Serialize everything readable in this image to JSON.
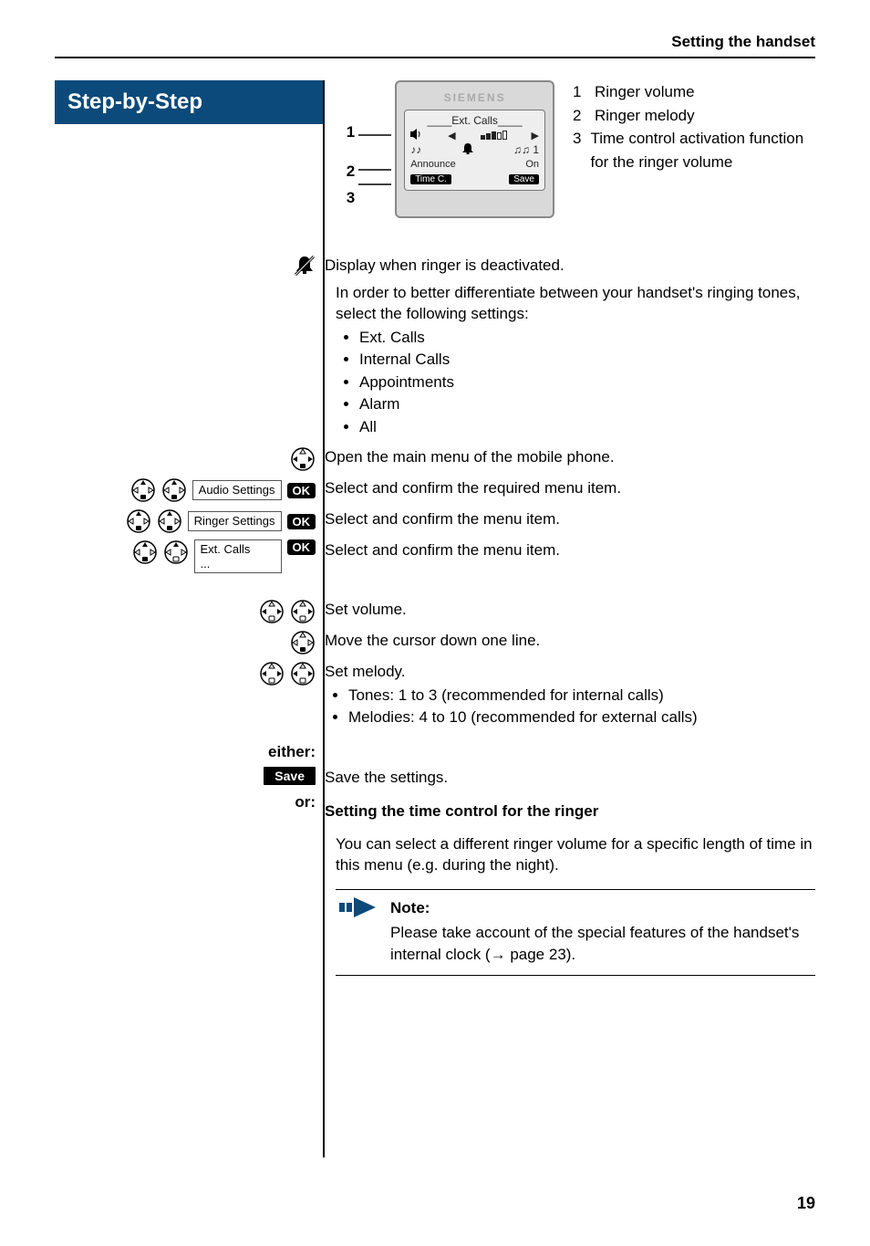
{
  "header": {
    "running": "Setting the handset"
  },
  "banner": "Step-by-Step",
  "device": {
    "brand": "SIEMENS",
    "title": "Ext. Calls",
    "announce": "Announce",
    "on": "On",
    "melodyNum": "1",
    "timec": "Time C.",
    "save": "Save",
    "callouts": {
      "n1": "1",
      "n2": "2",
      "n3": "3"
    }
  },
  "legend": {
    "r1": {
      "n": "1",
      "t": "Ringer volume"
    },
    "r2": {
      "n": "2",
      "t": "Ringer melody"
    },
    "r3": {
      "n": "3",
      "t": "Time control activation function for the ringer volume"
    }
  },
  "para": {
    "deactivated": "Display when ringer is deactivated.",
    "diff": "In order to better differentiate between your handset's ringing tones, select the following settings:",
    "openMain": "Open the main menu of the mobile phone.",
    "selectReq": "Select and confirm the required menu item.",
    "selectMenu": "Select and confirm the menu item.",
    "setVol": "Set volume.",
    "moveDown": "Move the cursor down one line.",
    "setMelody": "Set melody.",
    "saveSettings": "Save the settings.",
    "timeCtrlHead": "Setting the time control for the ringer",
    "timeCtrlBody": "You can select a different ringer volume for a specific length of time in this menu (e.g. during the night)."
  },
  "settingsList": [
    "Ext. Calls",
    "Internal Calls",
    "Appointments",
    "Alarm",
    "All"
  ],
  "melodyList": [
    "Tones: 1 to 3 (recommended for internal calls)",
    "Melodies: 4 to 10 (recommended for external calls)"
  ],
  "menuItems": {
    "audio": "Audio Settings",
    "ringer": "Ringer Settings",
    "ext": "Ext. Calls\n..."
  },
  "badges": {
    "ok": "OK",
    "save": "Save"
  },
  "labels": {
    "either": "either:",
    "or": "or:"
  },
  "note": {
    "title": "Note:",
    "body": "Please take account of the special features of the handset's internal clock (→ page 23)."
  },
  "pageNum": "19"
}
